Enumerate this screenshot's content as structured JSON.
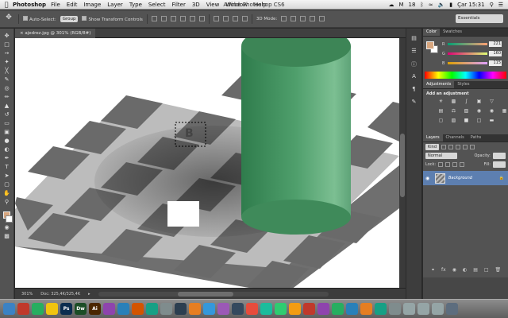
{
  "menubar": {
    "app_name": "Photoshop",
    "items": [
      "File",
      "Edit",
      "Image",
      "Layer",
      "Type",
      "Select",
      "Filter",
      "3D",
      "View",
      "Window",
      "Help"
    ],
    "window_title": "Adobe Photoshop CS6",
    "status_m": "M",
    "status_num": "18",
    "clock": "Çar 15:31"
  },
  "options": {
    "auto_select_label": "Auto-Select:",
    "auto_select_value": "Group",
    "transform_label": "Show Transform Controls",
    "mode_3d": "3D Mode:",
    "workspace": "Essentials"
  },
  "document": {
    "tab_title": "ajedrez.jpg @ 301% (RGB/8#)",
    "zoom": "301%",
    "doc_size": "Doc: 325,4K/325,4K",
    "selection_label": "B"
  },
  "color_panel": {
    "tabs": [
      "Color",
      "Swatches"
    ],
    "r_label": "R",
    "g_label": "G",
    "b_label": "B",
    "r": "221",
    "g": "160",
    "b": "115",
    "fg_color": "#d8a67e"
  },
  "adjustments_panel": {
    "tabs": [
      "Adjustments",
      "Styles"
    ],
    "heading": "Add an adjustment"
  },
  "layers_panel": {
    "tabs": [
      "Layers",
      "Channels",
      "Paths"
    ],
    "kind_label": "Kind",
    "blend_mode": "Normal",
    "opacity_label": "Opacity:",
    "lock_label": "Lock:",
    "fill_label": "Fill:",
    "layer_name": "Background"
  },
  "dock": {
    "apps": [
      {
        "label": "",
        "color": "#3b82c4"
      },
      {
        "label": "",
        "color": "#c0392b"
      },
      {
        "label": "",
        "color": "#27ae60"
      },
      {
        "label": "",
        "color": "#f1c40f"
      },
      {
        "label": "Ps",
        "color": "#0c2d4f"
      },
      {
        "label": "Dw",
        "color": "#1b4d26"
      },
      {
        "label": "Ai",
        "color": "#4a2600"
      }
    ]
  }
}
